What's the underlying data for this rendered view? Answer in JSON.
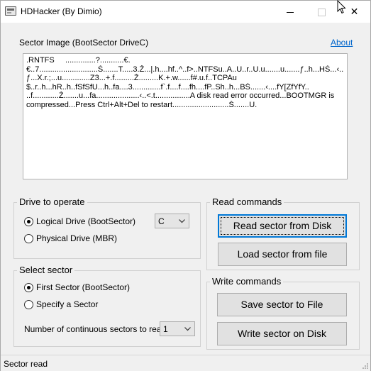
{
  "window": {
    "title": "HDHacker (By Dimio)",
    "controls": {
      "minimize": "minimize-icon",
      "maximize": "maximize-icon",
      "close": "✕"
    }
  },
  "sector_image": {
    "label": "Sector Image (BootSector DriveC)",
    "about_link": "About",
    "lines": [
      ".RNTFS     ..............?...........€.",
      "€..7...........................Š.......T.....3.Ž...|.h....hf..^..f>..NTFSu..A..U..r..U.u.......u.......ƒ..h...HŠ...‹.......",
      "ƒ...X.r.;...u.............Z3...+.f.........Ž.........K.+.w......f#.u.f..TCPAu",
      "$..r..h...hR..h..fSfSfU...h..fa....3.............f`.f....f....fh....fP..Sh..h...BŠ.......‹....fY[ZfYfY..",
      "..f............Ž.......u...fa....................‹..<.t................A disk read error occurred...BOOTMGR is",
      "compressed...Press Ctrl+Alt+Del to restart..........................Š.......U."
    ]
  },
  "drive_group": {
    "title": "Drive to operate",
    "options": [
      {
        "label": "Logical Drive (BootSector)",
        "checked": true
      },
      {
        "label": "Physical Drive (MBR)",
        "checked": false
      }
    ],
    "drive_value": "C"
  },
  "read_group": {
    "title": "Read commands",
    "read_disk_button": "Read sector from Disk",
    "load_file_button": "Load sector from file"
  },
  "select_group": {
    "title": "Select sector",
    "options": [
      {
        "label": "First Sector (BootSector)",
        "checked": true
      },
      {
        "label": "Specify a Sector",
        "checked": false
      }
    ],
    "count_label": "Number of continuous sectors to read:",
    "count_value": "1"
  },
  "write_group": {
    "title": "Write commands",
    "save_file_button": "Save sector to File",
    "write_disk_button": "Write sector on Disk"
  },
  "status": {
    "text": "Sector read"
  },
  "colors": {
    "accent": "#0078d7",
    "link": "#0066cc",
    "window_bg": "#f0f0f0"
  }
}
